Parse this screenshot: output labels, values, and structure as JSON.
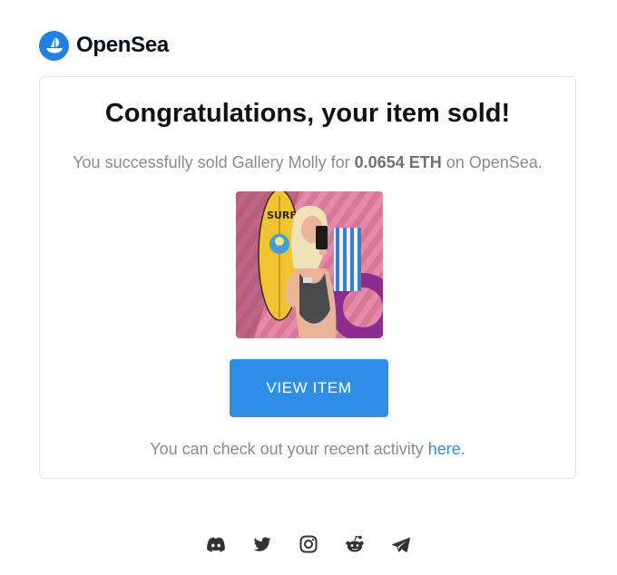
{
  "brand": {
    "name": "OpenSea",
    "accent": "#2081e2"
  },
  "email": {
    "title": "Congratulations, your item sold!",
    "subtitle_prefix": "You successfully sold Gallery Molly for ",
    "price": "0.0654 ETH",
    "subtitle_suffix": " on OpenSea.",
    "item_image": "nft-artwork-gallery-molly",
    "button_label": "VIEW ITEM",
    "activity_prefix": "You can check out your recent activity ",
    "activity_link": "here",
    "activity_suffix": "."
  },
  "footer": {
    "social_icons": [
      "discord-icon",
      "twitter-icon",
      "instagram-icon",
      "reddit-icon",
      "telegram-icon"
    ]
  }
}
